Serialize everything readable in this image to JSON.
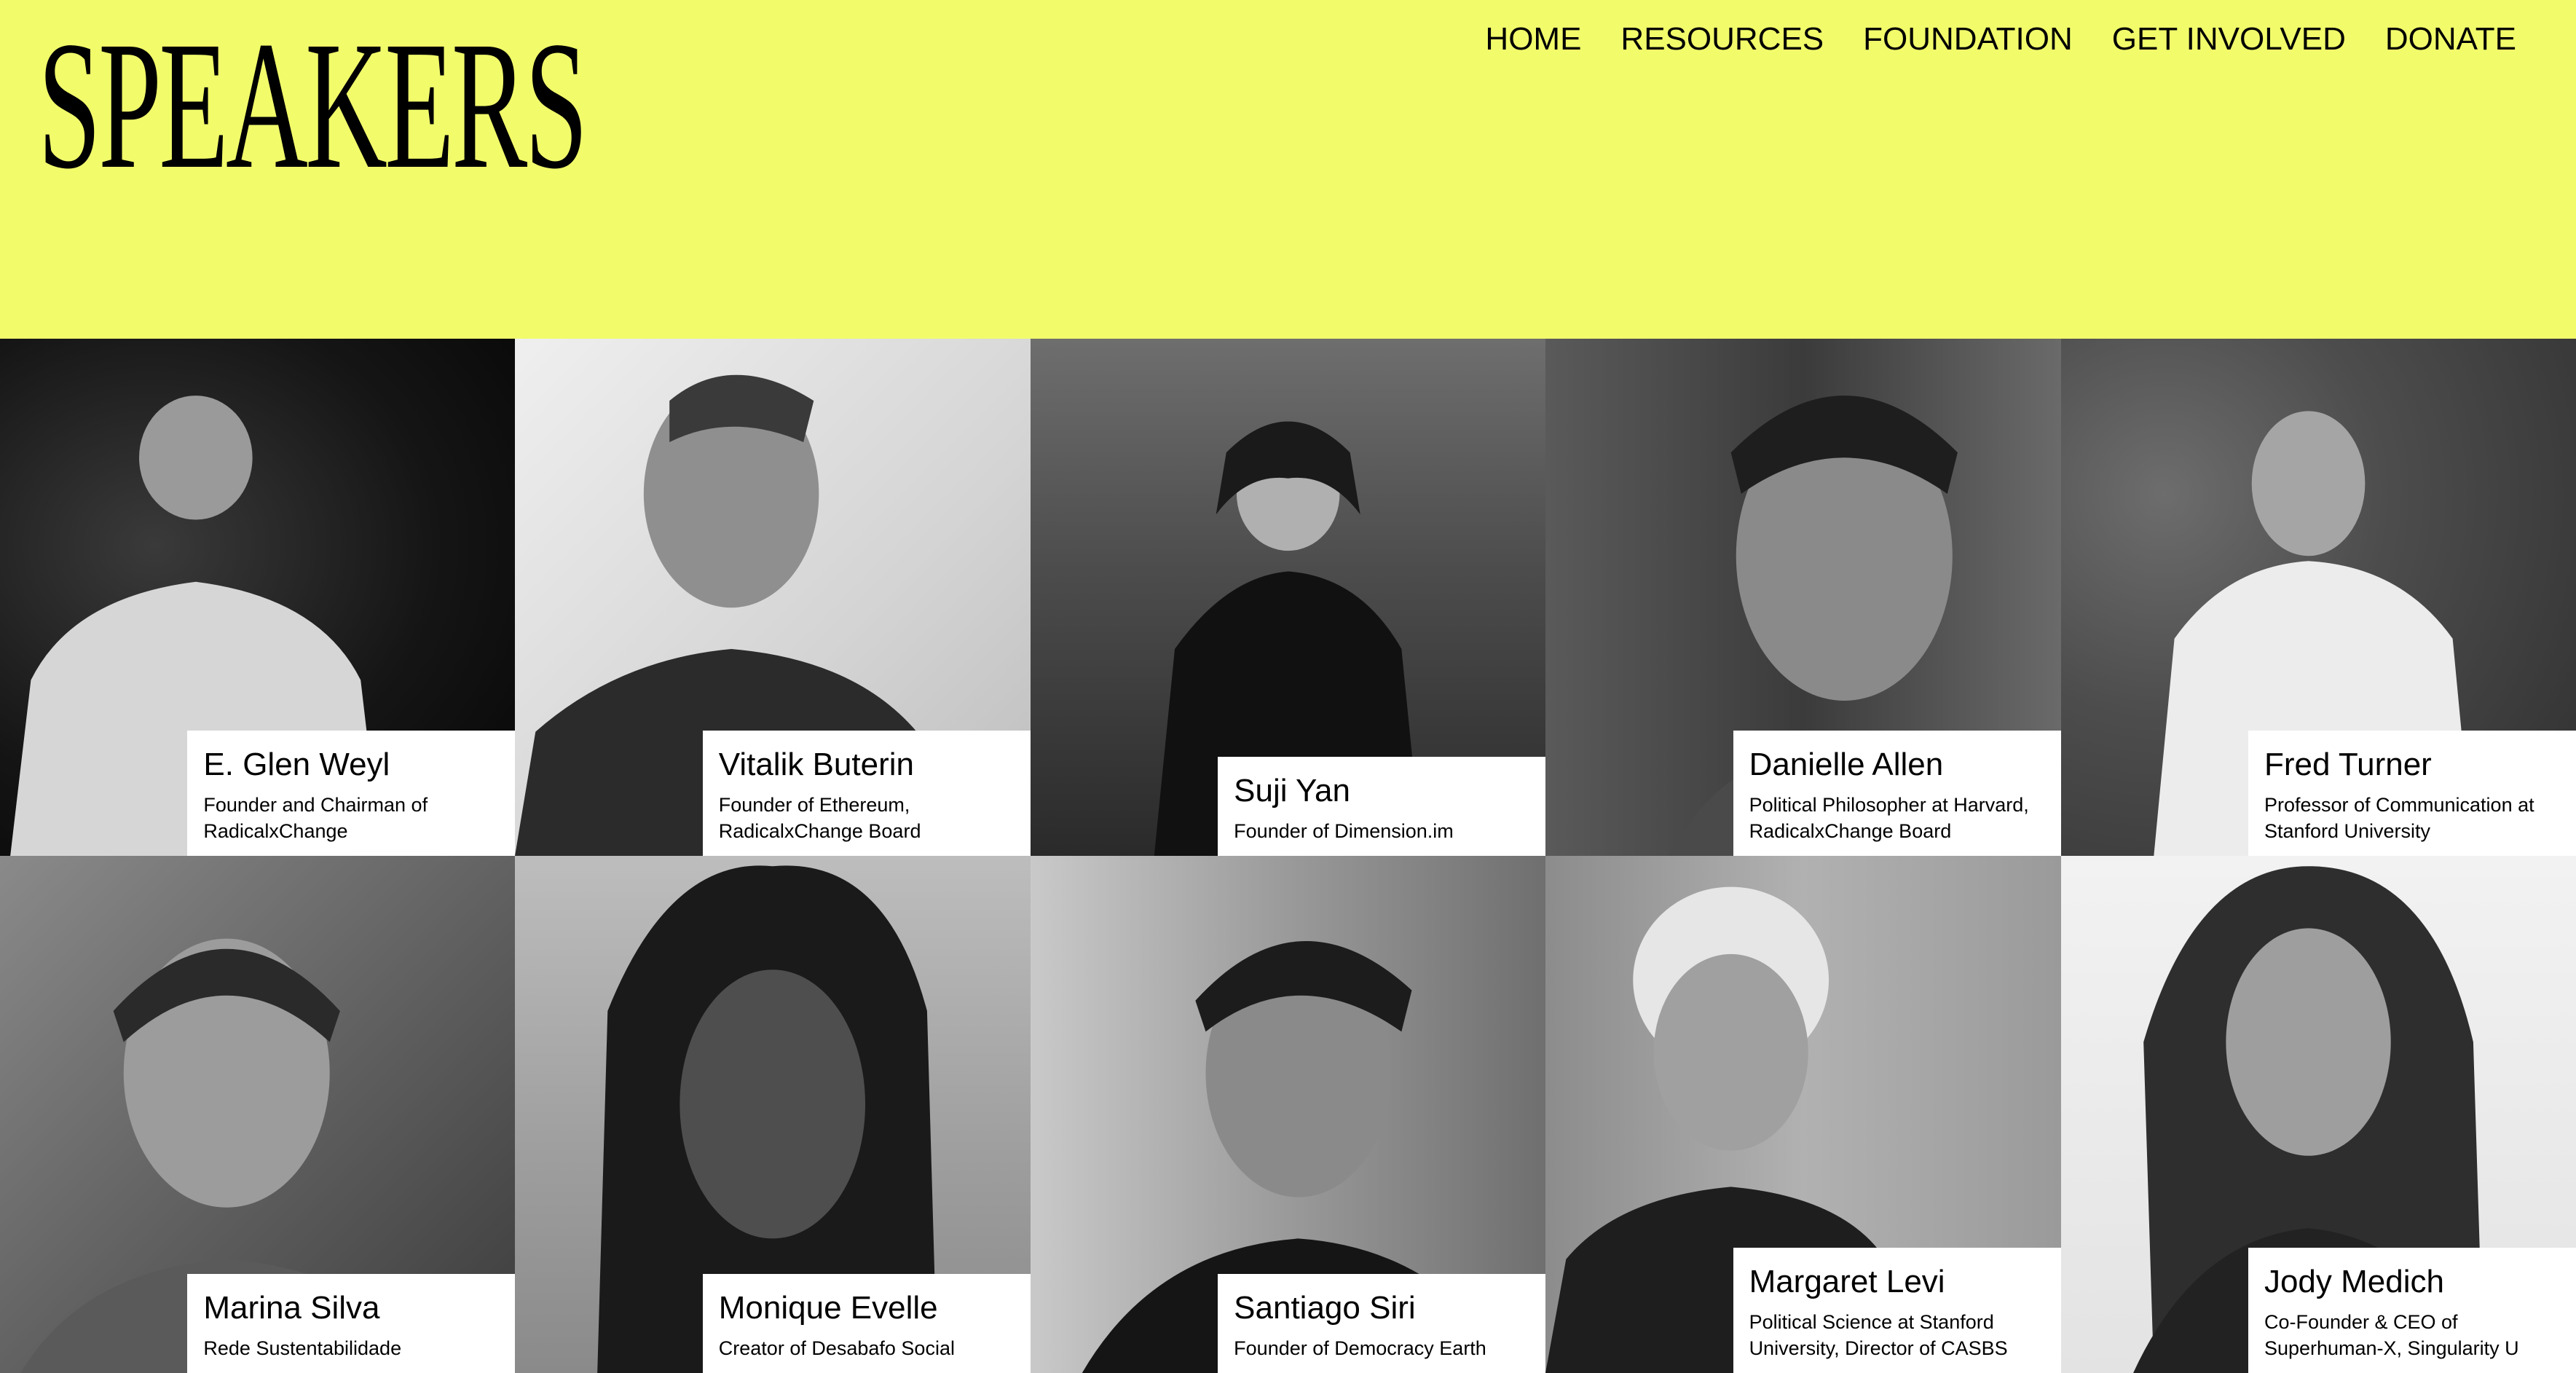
{
  "page": {
    "title": "SPEAKERS"
  },
  "nav": {
    "items": [
      {
        "label": "HOME"
      },
      {
        "label": "RESOURCES"
      },
      {
        "label": "FOUNDATION"
      },
      {
        "label": "GET INVOLVED"
      },
      {
        "label": "DONATE"
      }
    ]
  },
  "colors": {
    "background": "#f2fc6b",
    "caption_bg": "#ffffff",
    "text": "#000000"
  },
  "speakers": [
    {
      "name": "E. Glen Weyl",
      "role": "Founder and Chairman of\nRadicalxChange"
    },
    {
      "name": "Vitalik Buterin",
      "role": "Founder of Ethereum,\nRadicalxChange Board"
    },
    {
      "name": "Suji Yan",
      "role": "Founder of Dimension.im"
    },
    {
      "name": "Danielle Allen",
      "role": "Political Philosopher at Harvard,\nRadicalxChange Board"
    },
    {
      "name": "Fred Turner",
      "role": "Professor of Communication at\nStanford University"
    },
    {
      "name": "Marina Silva",
      "role": "Rede Sustentabilidade"
    },
    {
      "name": "Monique Evelle",
      "role": "Creator of Desabafo Social"
    },
    {
      "name": "Santiago Siri",
      "role": "Founder of Democracy Earth"
    },
    {
      "name": "Margaret Levi",
      "role": "Political Science at Stanford\nUniversity, Director of CASBS"
    },
    {
      "name": "Jody Medich",
      "role": "Co-Founder & CEO of\nSuperhuman-X, Singularity U"
    }
  ]
}
